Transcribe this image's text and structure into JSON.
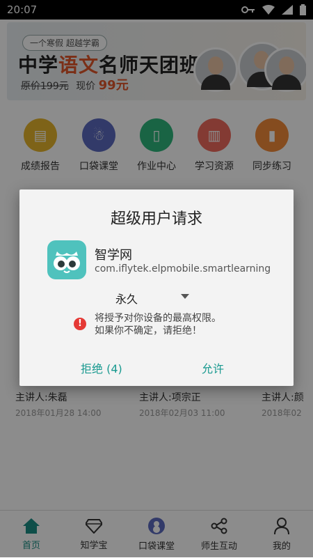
{
  "status_bar": {
    "time": "20:07"
  },
  "banner": {
    "slogan": "一个寒假 超越学霸",
    "title_pre": "中学",
    "title_accent": "语文",
    "title_post": "名师天团班",
    "original_price": "原价199元",
    "current_price_label": "现价",
    "current_price": "99元"
  },
  "quick_links": [
    {
      "label": "成绩报告",
      "icon": "report-icon",
      "color": "#e6b52c"
    },
    {
      "label": "口袋课堂",
      "icon": "snowman-icon",
      "color": "#5c6bc0"
    },
    {
      "label": "作业中心",
      "icon": "homework-icon",
      "color": "#2fb67c"
    },
    {
      "label": "学习资源",
      "icon": "books-icon",
      "color": "#ef6b5e"
    },
    {
      "label": "同步练习",
      "icon": "practice-icon",
      "color": "#f28b3a"
    }
  ],
  "cards": [
    {
      "speaker": "主讲人:朱磊",
      "time": "2018年01月28 14:00"
    },
    {
      "speaker": "主讲人:项宗正",
      "time": "2018年02月03 11:00"
    },
    {
      "speaker": "主讲人:颜",
      "time": "2018年02"
    }
  ],
  "dialog": {
    "title": "超级用户请求",
    "app_name": "智学网",
    "app_package": "com.iflytek.elpmobile.smartlearning",
    "duration": "永久",
    "warning_line1": "将授予对你设备的最高权限。",
    "warning_line2": "如果你不确定，请拒绝！",
    "deny_label": "拒绝 (4)",
    "allow_label": "允许"
  },
  "bottom_nav": [
    {
      "label": "首页",
      "icon": "home-icon",
      "active": true
    },
    {
      "label": "知学宝",
      "icon": "diamond-icon",
      "active": false
    },
    {
      "label": "口袋课堂",
      "icon": "snowman-icon",
      "active": false
    },
    {
      "label": "师生互动",
      "icon": "share-icon",
      "active": false
    },
    {
      "label": "我的",
      "icon": "user-icon",
      "active": false
    }
  ],
  "colors": {
    "accent": "#18998f",
    "price": "#e0562a",
    "warning": "#e53935"
  }
}
